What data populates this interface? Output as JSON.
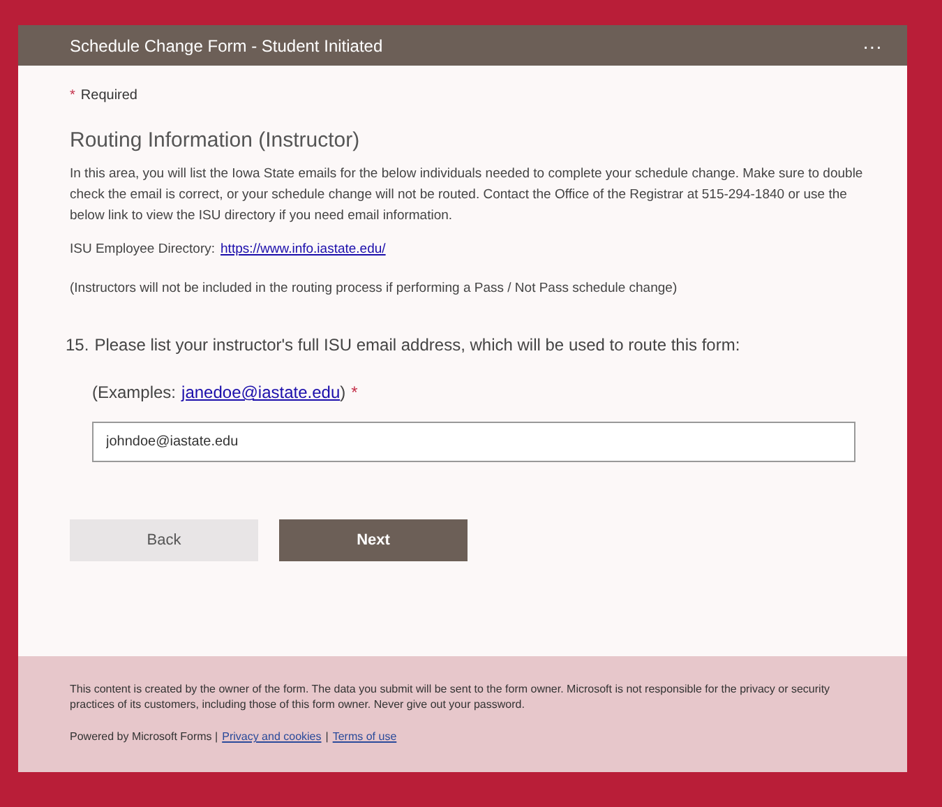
{
  "header": {
    "title": "Schedule Change Form - Student Initiated",
    "menu": "···"
  },
  "required_note": {
    "mark": "*",
    "label": "Required"
  },
  "section": {
    "title": "Routing Information (Instructor)",
    "description": "In this area, you will list the Iowa State emails for the below individuals needed to complete your schedule change. Make sure to double check the email is correct, or your schedule change will not be routed. Contact the Office of the Registrar at 515-294-1840 or use the below link to view the ISU directory if you need email information.",
    "directory_label": "ISU Employee Directory:",
    "directory_link": "https://www.info.iastate.edu/",
    "note": "(Instructors will not be included in the routing process if performing a Pass / Not Pass schedule change)"
  },
  "question": {
    "number": "15.",
    "text": "Please list your instructor's full ISU email address, which will be used to route this form:",
    "examples_prefix": "(Examples:",
    "examples_link": "janedoe@iastate.edu",
    "examples_suffix": ")",
    "required_mark": "*",
    "value": "johndoe@iastate.edu"
  },
  "buttons": [
    {
      "label": "Back",
      "kind": "secondary"
    },
    {
      "label": "Next",
      "kind": "primary"
    }
  ],
  "footer": {
    "disclaimer": "This content is created by the owner of the form. The data you submit will be sent to the form owner. Microsoft is not responsible for the privacy or security practices of its customers, including those of this form owner. Never give out your password.",
    "powered": "Powered by Microsoft Forms |",
    "links": [
      {
        "label": "Privacy and cookies"
      },
      {
        "label": "Terms of use"
      }
    ],
    "separator": "|"
  }
}
